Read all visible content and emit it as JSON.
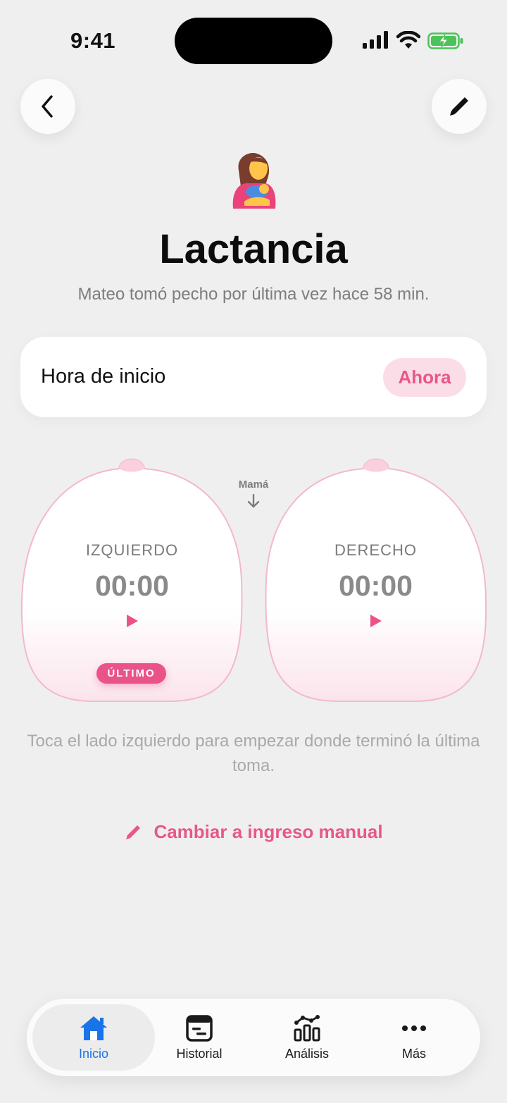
{
  "status_bar": {
    "time": "9:41"
  },
  "header": {
    "back_icon": "chevron-left-icon",
    "edit_icon": "pencil-icon",
    "emoji": "breastfeeding",
    "title": "Lactancia",
    "subtitle": "Mateo tomó pecho por última vez hace 58 min."
  },
  "start_time": {
    "label": "Hora de inicio",
    "value": "Ahora"
  },
  "sides": {
    "mom_label": "Mamá",
    "left": {
      "label": "IZQUIERDO",
      "time": "00:00",
      "badge": "ÚLTIMO"
    },
    "right": {
      "label": "DERECHO",
      "time": "00:00"
    }
  },
  "hint": "Toca el lado izquierdo para empezar donde terminó la última toma.",
  "manual_link": "Cambiar a ingreso manual",
  "tabs": [
    {
      "label": "Inicio",
      "icon": "home-icon",
      "active": true
    },
    {
      "label": "Historial",
      "icon": "calendar-list-icon",
      "active": false
    },
    {
      "label": "Análisis",
      "icon": "chart-icon",
      "active": false
    },
    {
      "label": "Más",
      "icon": "more-icon",
      "active": false
    }
  ],
  "colors": {
    "accent_pink": "#e8578a",
    "active_blue": "#1874e8",
    "background": "#efefef"
  }
}
